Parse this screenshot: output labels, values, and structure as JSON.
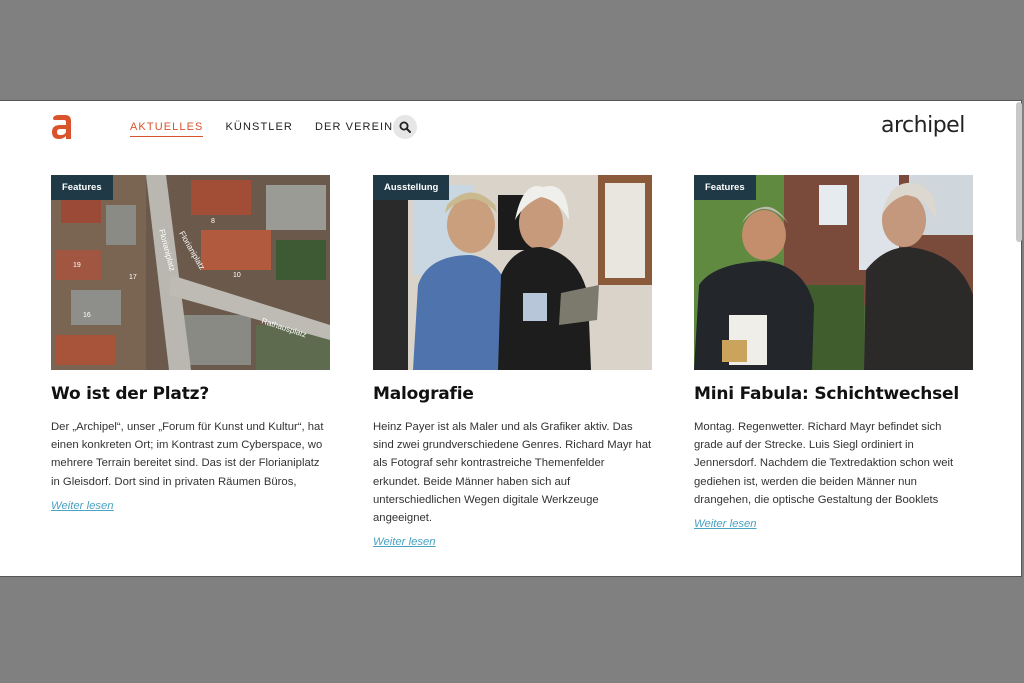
{
  "header": {
    "logo_letter": "a",
    "brand": "archipel",
    "nav": [
      {
        "label": "AKTUELLES",
        "active": true
      },
      {
        "label": "KÜNSTLER",
        "active": false
      },
      {
        "label": "DER VEREIN",
        "active": false
      }
    ],
    "search_icon": "search-icon"
  },
  "colors": {
    "accent": "#d9532c",
    "badge_bg": "#1f3a46",
    "link": "#4aa3c3"
  },
  "cards": [
    {
      "badge": "Features",
      "image": "aerial-map-photo",
      "map_labels": [
        "Florianiplatz",
        "Florianiplatz",
        "Rathausplatz",
        "19",
        "17",
        "16",
        "8",
        "10"
      ],
      "title": "Wo ist der Platz?",
      "excerpt": "Der „Archipel“, unser „Forum für Kunst und Kultur“, hat einen konkreten Ort; im Kontrast zum Cyberspace, wo mehrere Terrain bereitet sind. Das ist der Florianiplatz in Gleisdorf. Dort sind in privaten Räumen Büros,",
      "more": "Weiter lesen"
    },
    {
      "badge": "Ausstellung",
      "image": "two-men-in-gallery-photo",
      "title": "Malografie",
      "excerpt": "Heinz Payer ist als Maler und als Grafiker aktiv. Das sind zwei grundverschiedene Genres. Richard Mayr hat als Fotograf sehr kontrastreiche Themenfelder erkundet. Beide Männer haben sich auf unterschiedlichen Wegen digitale Werkzeuge angeeignet.",
      "more": "Weiter lesen"
    },
    {
      "badge": "Features",
      "image": "two-men-outdoors-photo",
      "title": "Mini Fabula: Schichtwechsel",
      "excerpt": "Montag. Regenwetter. Richard Mayr befindet sich grade auf der Strecke. Luis Siegl ordiniert in Jennersdorf. Nachdem die Textredaktion schon weit gediehen ist, werden die beiden Männer nun drangehen, die optische Gestaltung der Booklets",
      "more": "Weiter lesen"
    }
  ]
}
